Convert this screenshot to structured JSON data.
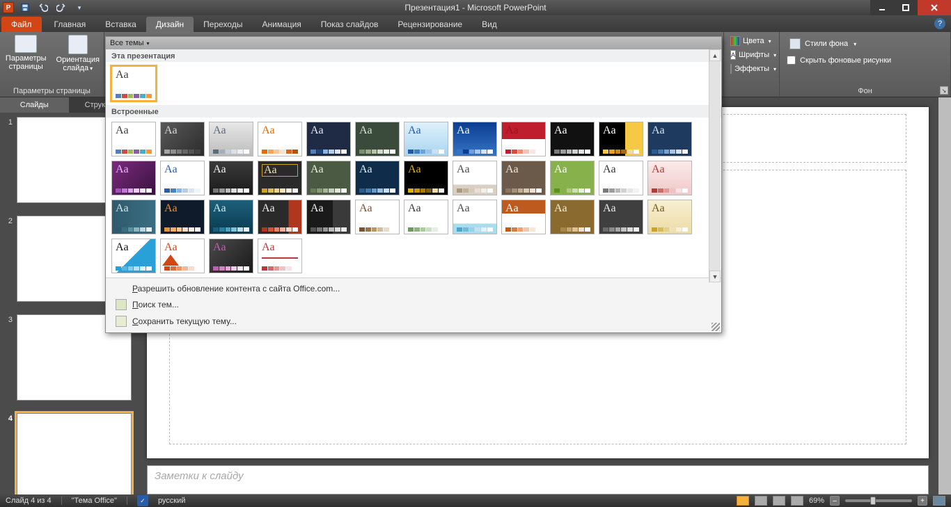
{
  "window": {
    "title": "Презентация1 - Microsoft PowerPoint"
  },
  "ribbon": {
    "tabs": [
      "Файл",
      "Главная",
      "Вставка",
      "Дизайн",
      "Переходы",
      "Анимация",
      "Показ слайдов",
      "Рецензирование",
      "Вид"
    ],
    "active": "Дизайн",
    "page_group": {
      "label": "Параметры страницы",
      "btn_params": "Параметры\nстраницы",
      "btn_orient": "Ориентация\nслайда"
    },
    "variants": {
      "colors": "Цвета",
      "fonts": "Шрифты",
      "effects": "Эффекты"
    },
    "bg_group": {
      "label": "Фон",
      "styles": "Стили фона",
      "hide": "Скрыть фоновые рисунки"
    }
  },
  "sidepane": {
    "tab_slides": "Слайды",
    "tab_outline": "Структура",
    "count": 4,
    "selected": 4
  },
  "notes": {
    "placeholder": "Заметки к слайду"
  },
  "status": {
    "slide_of": "Слайд 4 из 4",
    "theme": "\"Тема Office\"",
    "lang": "русский",
    "zoom": "69%"
  },
  "popup": {
    "header": "Все темы",
    "section_this": "Эта презентация",
    "section_builtin": "Встроенные",
    "footer_update": "Разрешить обновление контента с сайта Office.com...",
    "footer_search": "Поиск тем...",
    "footer_save": "Сохранить текущую тему..."
  },
  "themes_this": [
    {
      "bg": "#ffffff",
      "fg": "#3b3b3b",
      "strip": [
        "#4f81bd",
        "#c0504d",
        "#9bbb59",
        "#8064a2",
        "#4bacc6",
        "#f79646"
      ]
    }
  ],
  "themes_builtin": [
    {
      "bg": "#ffffff",
      "fg": "#3b3b3b",
      "strip": [
        "#4f81bd",
        "#c0504d",
        "#9bbb59",
        "#8064a2",
        "#4bacc6",
        "#f79646"
      ]
    },
    {
      "bg": "linear-gradient(135deg,#595959,#2b2b2b)",
      "fg": "#d8d8d8",
      "strip": [
        "#a5a5a5",
        "#8f8f8f",
        "#7a7a7a",
        "#666",
        "#555",
        "#444"
      ]
    },
    {
      "bg": "linear-gradient(#e7e7e7,#bcbcbc)",
      "fg": "#5c6b7a",
      "strip": [
        "#5c6b7a",
        "#a3b0bc",
        "#c8d1d9",
        "#dbe1e6",
        "#eef1f3",
        "#fff"
      ]
    },
    {
      "bg": "#ffffff",
      "fg": "#e46c0a",
      "strip": [
        "#e46c0a",
        "#f2a45e",
        "#f7c79b",
        "#fbe3cd",
        "#d2691e",
        "#b45309"
      ]
    },
    {
      "bg": "#1f2a44",
      "fg": "#e4e9f3",
      "strip": [
        "#4f81bd",
        "#1f497d",
        "#8cb4e2",
        "#b8cce4",
        "#dbe5f1",
        "#fff"
      ]
    },
    {
      "bg": "#3b4b3b",
      "fg": "#d7e0d0",
      "strip": [
        "#7b8f6e",
        "#9aab8a",
        "#b7c4aa",
        "#d2dac8",
        "#e9eee2",
        "#fff"
      ]
    },
    {
      "bg": "linear-gradient(#dff1fb,#a9d4ef)",
      "fg": "#1e5aa8",
      "strip": [
        "#1e5aa8",
        "#3f7ec2",
        "#6ea2d6",
        "#9cc4e7",
        "#c9e2f4",
        "#fff"
      ]
    },
    {
      "bg": "linear-gradient(#0b3d91,#3573c4)",
      "fg": "#ffffff",
      "strip": [
        "#3573c4",
        "#0b3d91",
        "#6fa1df",
        "#a7c7ee",
        "#d5e5f8",
        "#fff"
      ]
    },
    {
      "bg": "linear-gradient(#bf1e2e 50%,#fff 50%)",
      "fg": "#a01016",
      "strip": [
        "#bf1e2e",
        "#e0483f",
        "#ef8b7b",
        "#f7c1b7",
        "#fce4df",
        "#fff"
      ]
    },
    {
      "bg": "#111",
      "fg": "#fff",
      "strip": [
        "#7a7a7a",
        "#9c9c9c",
        "#b8b8b8",
        "#d1d1d1",
        "#e5e5e5",
        "#fff"
      ]
    },
    {
      "bg": "linear-gradient(90deg,#000 60%,#f6c945 60%)",
      "fg": "#fff",
      "strip": [
        "#f6c945",
        "#e5a31e",
        "#c98820",
        "#a66b14",
        "#f3dca0",
        "#fff"
      ]
    },
    {
      "bg": "#1e3a5f",
      "fg": "#d6e2f0",
      "strip": [
        "#2f5c8f",
        "#4a7ab0",
        "#7ba1cc",
        "#a9c3e0",
        "#d4e1f0",
        "#fff"
      ]
    },
    {
      "bg": "linear-gradient(135deg,#7b2a7d,#3a1240)",
      "fg": "#e9b6ff",
      "strip": [
        "#a24fbb",
        "#c07ad5",
        "#d7a7e6",
        "#eacff2",
        "#f5e9f9",
        "#fff"
      ]
    },
    {
      "bg": "#ffffff",
      "fg": "#2a5caa",
      "strip": [
        "#2a5caa",
        "#4f81bd",
        "#8cb4e2",
        "#b8cce4",
        "#dbe5f1",
        "#eef4fa"
      ]
    },
    {
      "bg": "linear-gradient(#3a3a3a,#1a1a1a)",
      "fg": "#f2f2f2",
      "strip": [
        "#777",
        "#999",
        "#bbb",
        "#ddd",
        "#eee",
        "#fff"
      ]
    },
    {
      "bg": "#2a2a2a",
      "fg": "#f4e1b5",
      "border": "#c9a227",
      "strip": [
        "#c9a227",
        "#e0bd58",
        "#ecd390",
        "#f4e5bc",
        "#faf2dd",
        "#fff"
      ]
    },
    {
      "bg": "#4a5a43",
      "fg": "#e9efe1",
      "strip": [
        "#6b7d5d",
        "#8a9a79",
        "#a9b69a",
        "#c6cfbb",
        "#e2e7da",
        "#fff"
      ]
    },
    {
      "bg": "#0f2d4a",
      "fg": "#e0eaf3",
      "strip": [
        "#2a5c8a",
        "#3f78ab",
        "#6a9ac6",
        "#9bbedd",
        "#cadef0",
        "#fff"
      ]
    },
    {
      "bg": "#000000",
      "fg": "#e2b007",
      "strip": [
        "#e2b007",
        "#c99706",
        "#a67a05",
        "#7f5d03",
        "#f3dca0",
        "#fff"
      ]
    },
    {
      "bg": "linear-gradient(#fff 70%,#d9d0c3 70%)",
      "fg": "#4a4a4a",
      "strip": [
        "#a9997f",
        "#c0b39c",
        "#d5cbb9",
        "#e7e0d4",
        "#f3efe9",
        "#fff"
      ]
    },
    {
      "bg": "#6b5a49",
      "fg": "#efe6d8",
      "strip": [
        "#8a775f",
        "#a5927a",
        "#bfad97",
        "#d7c9b6",
        "#ece3d6",
        "#fff"
      ]
    },
    {
      "bg": "#87b14a",
      "fg": "#ffffff",
      "strip": [
        "#5e8f1f",
        "#87b14a",
        "#aecb80",
        "#cfe1b3",
        "#e9f1da",
        "#fff"
      ]
    },
    {
      "bg": "#ffffff",
      "fg": "#333",
      "strip": [
        "#7a7a7a",
        "#9c9c9c",
        "#b8b8b8",
        "#d1d1d1",
        "#e5e5e5",
        "#f2f2f2"
      ]
    },
    {
      "bg": "linear-gradient(#fbeaea,#f0c8c8)",
      "fg": "#b33a3a",
      "strip": [
        "#b33a3a",
        "#cc6b6b",
        "#df9a9a",
        "#edc3c3",
        "#f7e3e3",
        "#fff"
      ]
    },
    {
      "bg": "linear-gradient(90deg,#2f5a6b,#3a6e82)",
      "fg": "#cfe6ef",
      "strip": [
        "#2f5a6b",
        "#3a6e82",
        "#5c8fa0",
        "#8cb3c0",
        "#bcd6df",
        "#e8f1f5"
      ]
    },
    {
      "bg": "#0f1a2b",
      "fg": "#e69138",
      "strip": [
        "#e69138",
        "#f2ad62",
        "#f7c793",
        "#fbe0c3",
        "#fdf1e3",
        "#fff"
      ]
    },
    {
      "bg": "linear-gradient(#1c5f7a,#0a3a4f)",
      "fg": "#cdeef7",
      "strip": [
        "#1c5f7a",
        "#2a7f9e",
        "#4fa1bd",
        "#83c2d6",
        "#b9dfeb",
        "#e6f3f8"
      ]
    },
    {
      "bg": "linear-gradient(90deg,#2a2a2a 70%,#b0361d 70%)",
      "fg": "#f0f0f0",
      "strip": [
        "#b0361d",
        "#d0563b",
        "#e28568",
        "#eeb19b",
        "#f7d8cd",
        "#fff"
      ]
    },
    {
      "bg": "linear-gradient(90deg,#1a1a1a 60%,#3a3a3a 60%)",
      "fg": "#f2f2f2",
      "strip": [
        "#555",
        "#777",
        "#999",
        "#bbb",
        "#ddd",
        "#eee"
      ]
    },
    {
      "bg": "#ffffff",
      "fg": "#7a5230",
      "strip": [
        "#7a5230",
        "#9b724d",
        "#b89572",
        "#d2ba9e",
        "#e8dbca",
        "#fff"
      ]
    },
    {
      "bg": "#ffffff",
      "fg": "#3b3b3b",
      "strip": [
        "#6a9a5e",
        "#8bb47e",
        "#aacb9f",
        "#c9e0c2",
        "#e5f0e2",
        "#fff"
      ]
    },
    {
      "bg": "linear-gradient(#fff 70%,#aadcf0 70%)",
      "fg": "#4a4a4a",
      "strip": [
        "#4aa5cc",
        "#6fbad9",
        "#99d0e5",
        "#c1e3f0",
        "#e3f3f9",
        "#fff"
      ]
    },
    {
      "bg": "linear-gradient(#bf5a1f 40%,#fff 40%)",
      "fg": "#fff",
      "strip": [
        "#bf5a1f",
        "#d87d44",
        "#e7a276",
        "#f1c6aa",
        "#f9e4d6",
        "#fff"
      ]
    },
    {
      "bg": "#8a6a2f",
      "fg": "#f7eed3",
      "strip": [
        "#8a6a2f",
        "#a88646",
        "#c4a56a",
        "#dbc396",
        "#ede0c4",
        "#fff"
      ]
    },
    {
      "bg": "#3f3f3f",
      "fg": "#ededed",
      "strip": [
        "#6b6b6b",
        "#8a8a8a",
        "#a6a6a6",
        "#c3c3c3",
        "#dcdcdc",
        "#f2f2f2"
      ]
    },
    {
      "bg": "linear-gradient(#f7efd2,#ecdca5)",
      "fg": "#6d5a1f",
      "strip": [
        "#c9a227",
        "#d8ba5b",
        "#e4cf8c",
        "#efe1b8",
        "#f7f0dc",
        "#fff"
      ]
    },
    {
      "bg": "linear-gradient(135deg,#fff 50%,#2aa0d8 50%)",
      "fg": "#111",
      "strip": [
        "#2aa0d8",
        "#55b6e1",
        "#86cdec",
        "#b5e1f4",
        "#def2fa",
        "#fff"
      ]
    },
    {
      "bg": "#ffffff",
      "fg": "#d24615",
      "shape": "tri",
      "strip": [
        "#d24615",
        "#e06a3b",
        "#eb9069",
        "#f3b69b",
        "#f9dbcd",
        "#fff"
      ]
    },
    {
      "bg": "linear-gradient(135deg,#4a4a4a,#1a1a1a)",
      "fg": "#c05eb3",
      "strip": [
        "#c05eb3",
        "#d183c7",
        "#e0a9d9",
        "#edceea",
        "#f7e9f5",
        "#fff"
      ]
    },
    {
      "bg": "#ffffff",
      "fg": "#b33a3a",
      "line": true,
      "strip": [
        "#b33a3a",
        "#cc6b6b",
        "#df9a9a",
        "#edc3c3",
        "#f7e3e3",
        "#fff"
      ]
    }
  ]
}
